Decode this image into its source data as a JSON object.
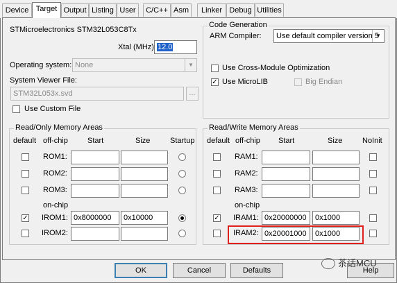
{
  "tabs": [
    "Device",
    "Target",
    "Output",
    "Listing",
    "User",
    "C/C++",
    "Asm",
    "Linker",
    "Debug",
    "Utilities"
  ],
  "device_name": "STMicroelectronics STM32L053C8Tx",
  "xtal": {
    "label": "Xtal (MHz):",
    "value": "12.0"
  },
  "os": {
    "label": "Operating system:",
    "value": "None"
  },
  "svf": {
    "label": "System Viewer File:",
    "value": "STM32L053x.svd",
    "browse": "..."
  },
  "custom_file": {
    "label": "Use Custom File",
    "checked": false
  },
  "code_gen": {
    "title": "Code Generation",
    "compiler_label": "ARM Compiler:",
    "compiler_value": "Use default compiler version 5",
    "cross_module": {
      "label": "Use Cross-Module Optimization",
      "checked": false
    },
    "microlib": {
      "label": "Use MicroLIB",
      "checked": true
    },
    "big_endian": {
      "label": "Big Endian",
      "checked": false
    }
  },
  "ro_mem": {
    "title": "Read/Only Memory Areas",
    "headers": {
      "default": "default",
      "offchip": "off-chip",
      "start": "Start",
      "size": "Size",
      "startup": "Startup"
    },
    "onchip_label": "on-chip",
    "rows": [
      {
        "name": "ROM1:",
        "start": "",
        "size": "",
        "default": false,
        "startup": false
      },
      {
        "name": "ROM2:",
        "start": "",
        "size": "",
        "default": false,
        "startup": false
      },
      {
        "name": "ROM3:",
        "start": "",
        "size": "",
        "default": false,
        "startup": false
      },
      {
        "name": "IROM1:",
        "start": "0x8000000",
        "size": "0x10000",
        "default": true,
        "startup": true
      },
      {
        "name": "IROM2:",
        "start": "",
        "size": "",
        "default": false,
        "startup": false
      }
    ]
  },
  "rw_mem": {
    "title": "Read/Write Memory Areas",
    "headers": {
      "default": "default",
      "offchip": "off-chip",
      "start": "Start",
      "size": "Size",
      "noinit": "NoInit"
    },
    "onchip_label": "on-chip",
    "rows": [
      {
        "name": "RAM1:",
        "start": "",
        "size": "",
        "default": false,
        "noinit": false
      },
      {
        "name": "RAM2:",
        "start": "",
        "size": "",
        "default": false,
        "noinit": false
      },
      {
        "name": "RAM3:",
        "start": "",
        "size": "",
        "default": false,
        "noinit": false
      },
      {
        "name": "IRAM1:",
        "start": "0x20000000",
        "size": "0x1000",
        "default": true,
        "noinit": false
      },
      {
        "name": "IRAM2:",
        "start": "0x20001000",
        "size": "0x1000",
        "default": false,
        "noinit": false
      }
    ]
  },
  "buttons": {
    "ok": "OK",
    "cancel": "Cancel",
    "defaults": "Defaults",
    "help": "Help"
  },
  "watermark": "茶话MCU",
  "colors": {
    "selection": "#1f62c9",
    "highlight": "#e0201c",
    "default_button_border": "#3c7fb1"
  }
}
